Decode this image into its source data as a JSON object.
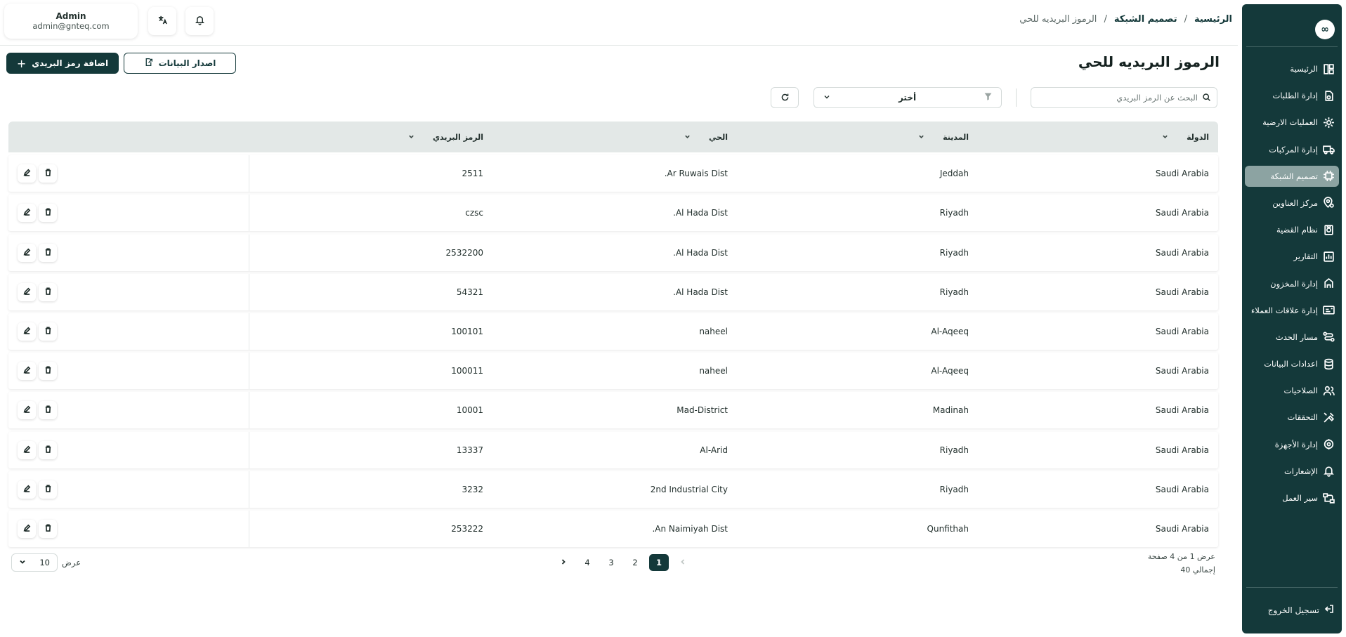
{
  "header": {
    "breadcrumb": [
      "الرئيسية",
      "تصميم الشبكة",
      "الرموز البريديه للحي"
    ],
    "user_name": "Admin",
    "user_email": "admin@gnteq.com",
    "translate_icon": "translate-icon",
    "bell_icon": "bell-icon"
  },
  "sidebar": {
    "logo": "∞",
    "items": [
      {
        "label": "الرئيسية",
        "icon": "dashboard-icon",
        "active": false
      },
      {
        "label": "إدارة الطلبات",
        "icon": "orders-icon",
        "active": false
      },
      {
        "label": "العمليات الارضية",
        "icon": "ground-ops-icon",
        "active": false
      },
      {
        "label": "إدارة المركبات",
        "icon": "truck-icon",
        "active": false
      },
      {
        "label": "تصميم الشبكة",
        "icon": "network-icon",
        "active": true
      },
      {
        "label": "مركز العناوين",
        "icon": "location-icon",
        "active": false
      },
      {
        "label": "نظام القضية",
        "icon": "case-icon",
        "active": false
      },
      {
        "label": "التقارير",
        "icon": "reports-icon",
        "active": false
      },
      {
        "label": "إدارة المخزون",
        "icon": "inventory-icon",
        "active": false
      },
      {
        "label": "إدارة علاقات العملاء",
        "icon": "crm-icon",
        "active": false
      },
      {
        "label": "مسار الحدث",
        "icon": "route-icon",
        "active": false
      },
      {
        "label": "اعدادات البيانات",
        "icon": "database-icon",
        "active": false
      },
      {
        "label": "الصلاحيات",
        "icon": "users-icon",
        "active": false
      },
      {
        "label": "التحققات",
        "icon": "verify-icon",
        "active": false
      },
      {
        "label": "إدارة الأجهزة",
        "icon": "devices-icon",
        "active": false
      },
      {
        "label": "الإشعارات",
        "icon": "bell-icon",
        "active": false
      },
      {
        "label": "سير العمل",
        "icon": "workflow-icon",
        "active": false
      }
    ],
    "logout_label": "تسجيل الخروج"
  },
  "page": {
    "title": "الرموز البريديه للحي",
    "add_button": "اضافة رمز البريدي",
    "export_button": "اصدار البيانات",
    "search_placeholder": "البحث عن الرمز البريدي",
    "filter_select": "أختر"
  },
  "table": {
    "columns": [
      "الدولة",
      "المدينة",
      "الحي",
      "الرمز البريدي"
    ],
    "rows": [
      {
        "country": "Saudi Arabia",
        "city": "Jeddah",
        "district": "Ar Ruwais Dist.",
        "zip": "2511"
      },
      {
        "country": "Saudi Arabia",
        "city": "Riyadh",
        "district": "Al Hada Dist.",
        "zip": "czsc"
      },
      {
        "country": "Saudi Arabia",
        "city": "Riyadh",
        "district": "Al Hada Dist.",
        "zip": "2532200"
      },
      {
        "country": "Saudi Arabia",
        "city": "Riyadh",
        "district": "Al Hada Dist.",
        "zip": "54321"
      },
      {
        "country": "Saudi Arabia",
        "city": "Al-Aqeeq",
        "district": "naheel",
        "zip": "100101"
      },
      {
        "country": "Saudi Arabia",
        "city": "Al-Aqeeq",
        "district": "naheel",
        "zip": "100011"
      },
      {
        "country": "Saudi Arabia",
        "city": "Madinah",
        "district": "Mad-District",
        "zip": "10001"
      },
      {
        "country": "Saudi Arabia",
        "city": "Riyadh",
        "district": "Al-Arid",
        "zip": "13337"
      },
      {
        "country": "Saudi Arabia",
        "city": "Riyadh",
        "district": "2nd Industrial City",
        "zip": "3232"
      },
      {
        "country": "Saudi Arabia",
        "city": "Qunfithah",
        "district": "An Naimiyah Dist.",
        "zip": "253222"
      }
    ]
  },
  "footer": {
    "page_info": "عرض 1 من 4 صفحة",
    "total": "إجمالي 40",
    "pages": [
      "1",
      "2",
      "3",
      "4"
    ],
    "current_page": "1",
    "per_page_label": "عرض",
    "per_page_value": "10"
  },
  "colors": {
    "primary": "#14393a",
    "sidebar_active": "#8ca3a2",
    "table_header": "#e3e8e7"
  }
}
